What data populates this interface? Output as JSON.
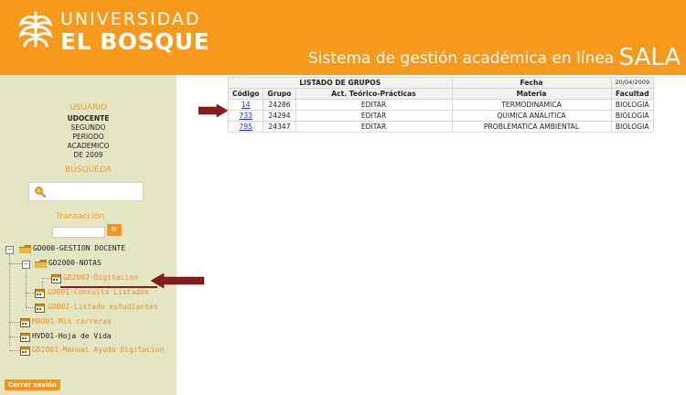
{
  "header": {
    "brand_line1": "UNIVERSIDAD",
    "brand_line2": "EL BOSQUE",
    "system_title": "Sistema de gestión académica en línea",
    "system_title_big": "SALA",
    "brand_color": "#f79a1b"
  },
  "sidebar": {
    "usuario_label": "USUARIO",
    "user_name": "UDOCENTE",
    "period_lines": [
      "SEGUNDO",
      "PERIODO",
      "ACADEMICO",
      "DE 2009"
    ],
    "busqueda_label": "BÚSQUEDA",
    "transaccion_label": "Transacción",
    "ir_label": "Ir",
    "cerrar_label": "Cerrar sesión",
    "tree": [
      {
        "label": "GD000-GESTION DOCENTE"
      },
      {
        "label": "GD2000-NOTAS"
      },
      {
        "label": "GD2002-Digitacion"
      },
      {
        "label": "GD001-Consulta Listados"
      },
      {
        "label": "GD002-Listado estudiantes"
      },
      {
        "label": "M0001-Mis carreras"
      },
      {
        "label": "HVD01-Hoja de Vida"
      },
      {
        "label": "GD2001-Manual Ayuda Digitacion"
      }
    ]
  },
  "table": {
    "title": "LISTADO DE GRUPOS",
    "fecha_label": "Fecha",
    "fecha_value": "20/04/2009",
    "headers": [
      "Código",
      "Grupo",
      "Act. Teórico-Prácticas",
      "Materia",
      "Facultad"
    ],
    "rows": [
      {
        "codigo": "14",
        "grupo": "24286",
        "accion": "EDITAR",
        "materia": "TERMODINAMICA",
        "facultad": "BIOLOGIA"
      },
      {
        "codigo": "733",
        "grupo": "24294",
        "accion": "EDITAR",
        "materia": "QUIMICA ANALITICA",
        "facultad": "BIOLOGIA"
      },
      {
        "codigo": "795",
        "grupo": "24347",
        "accion": "EDITAR",
        "materia": "PROBLEMATICA AMBIENTAL",
        "facultad": "BIOLOGIA"
      }
    ]
  },
  "icons": {
    "logo": "university-logo-icon",
    "search": "magnifier-icon",
    "folder": "folder-icon",
    "document": "calendar-document-icon",
    "arrow": "red-arrow-icon"
  },
  "colors": {
    "accent": "#f79a1b",
    "sidebar_bg": "#e4e6c3",
    "link": "#1a33c8",
    "arrow": "#8b1a1a"
  }
}
